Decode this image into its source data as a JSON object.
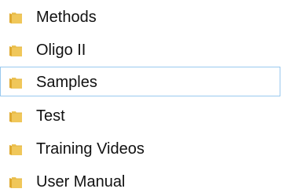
{
  "folders": [
    {
      "label": "Methods",
      "icon": "folder-icon"
    },
    {
      "label": "Oligo II",
      "icon": "folder-icon"
    },
    {
      "label": "Samples",
      "icon": "folder-icon",
      "selected": true
    },
    {
      "label": "Test",
      "icon": "folder-icon"
    },
    {
      "label": "Training Videos",
      "icon": "folder-icon"
    },
    {
      "label": "User Manual",
      "icon": "folder-icon"
    }
  ],
  "colors": {
    "folder_body": "#f0c75a",
    "folder_back": "#dfa92f",
    "selection_border": "#99c9ef"
  }
}
